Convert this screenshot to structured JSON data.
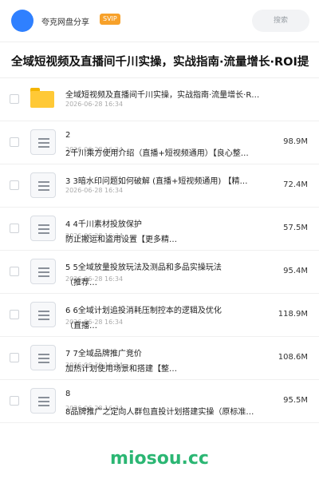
{
  "header": {
    "site_name": "夸克网盘分享",
    "badge": "SVIP",
    "search_placeholder": "搜索"
  },
  "page_title": "全域短视频及直播间千川实操，实战指南·流量增长·ROI提",
  "files": [
    {
      "type": "folder",
      "name_line1": "全域短视频及直播间千川实操，实战指南·流量增长·R…",
      "name_line2": "",
      "date": "2026-06-28 16:34",
      "size": ""
    },
    {
      "type": "file",
      "name_line1": "2",
      "name_line2": "2千川乘方使用介绍（直播+短视频通用）【良心整…",
      "date": "2026-06-28 16:34",
      "size": "98.9M"
    },
    {
      "type": "file",
      "name_line1": "3 3暗水印问题如何破解 (直播+短视频通用) 【精…",
      "name_line2": "",
      "date": "2026-06-28 16:34",
      "size": "72.4M"
    },
    {
      "type": "file",
      "name_line1": "4 4千川素材投放保护",
      "name_line2": "防止搬运和盗用设置【更多精…",
      "date": "2026-06-28 16:34",
      "size": "57.5M"
    },
    {
      "type": "file",
      "name_line1": "5 5全域放量投放玩法及测品和多品实操玩法",
      "name_line2": "（推荐…",
      "date": "2026-06-28 16:34",
      "size": "95.4M"
    },
    {
      "type": "file",
      "name_line1": "6 6全域计划追投消耗压制控本的逻辑及优化",
      "name_line2": "（直播…",
      "date": "2026-06-28 16:34",
      "size": "118.9M"
    },
    {
      "type": "file",
      "name_line1": "7 7全域品牌推广竞价",
      "name_line2": "加热计划使用场景和搭建【整…",
      "date": "2026-06-28 16:34",
      "size": "108.6M"
    },
    {
      "type": "file",
      "name_line1": "8",
      "name_line2": "8品牌推广之定向人群包直投计划搭建实操（原标准…",
      "date": "2026-06-28 16:34",
      "size": "95.5M"
    }
  ],
  "watermark": "miosou.cc",
  "colors": {
    "accent": "#2f80ff",
    "svip": "#f7a12a",
    "folder": "#ffc936",
    "watermark": "#2bb673"
  }
}
